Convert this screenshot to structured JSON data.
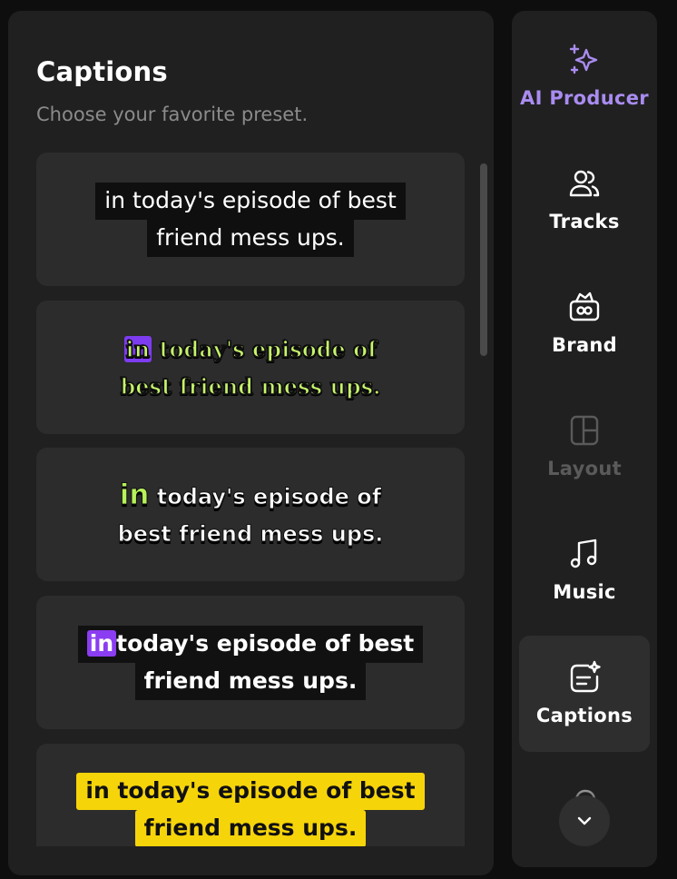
{
  "captions_panel": {
    "title": "Captions",
    "subtitle": "Choose your favorite preset.",
    "presets": [
      {
        "line1": "in today's episode of best",
        "line2": "friend mess ups."
      },
      {
        "highlight": "in",
        "line1_rest": " today's episode of",
        "line2": "best friend mess ups."
      },
      {
        "highlight": "in",
        "line1_rest": " today's episode of",
        "line2": "best friend mess ups."
      },
      {
        "highlight": "in",
        "line1_rest": "today's episode of best",
        "line2": "friend mess ups."
      },
      {
        "line1": "in today's episode of best",
        "line2": "friend mess ups."
      }
    ]
  },
  "nav": {
    "items": [
      {
        "label": "AI Producer",
        "icon": "sparkles-icon",
        "color": "#a98cf0"
      },
      {
        "label": "Tracks",
        "icon": "users-icon"
      },
      {
        "label": "Brand",
        "icon": "brand-kit-icon"
      },
      {
        "label": "Layout",
        "icon": "layout-icon",
        "disabled": true
      },
      {
        "label": "Music",
        "icon": "music-note-icon"
      },
      {
        "label": "Captions",
        "icon": "captions-icon",
        "active": true
      }
    ],
    "scroll_down_icon": "chevron-down-icon"
  },
  "colors": {
    "ai_accent": "#a98cf0",
    "highlight_purple": "#8b3df1",
    "caption_green": "#c7f56a",
    "caption_yellow": "#f6d40a"
  }
}
